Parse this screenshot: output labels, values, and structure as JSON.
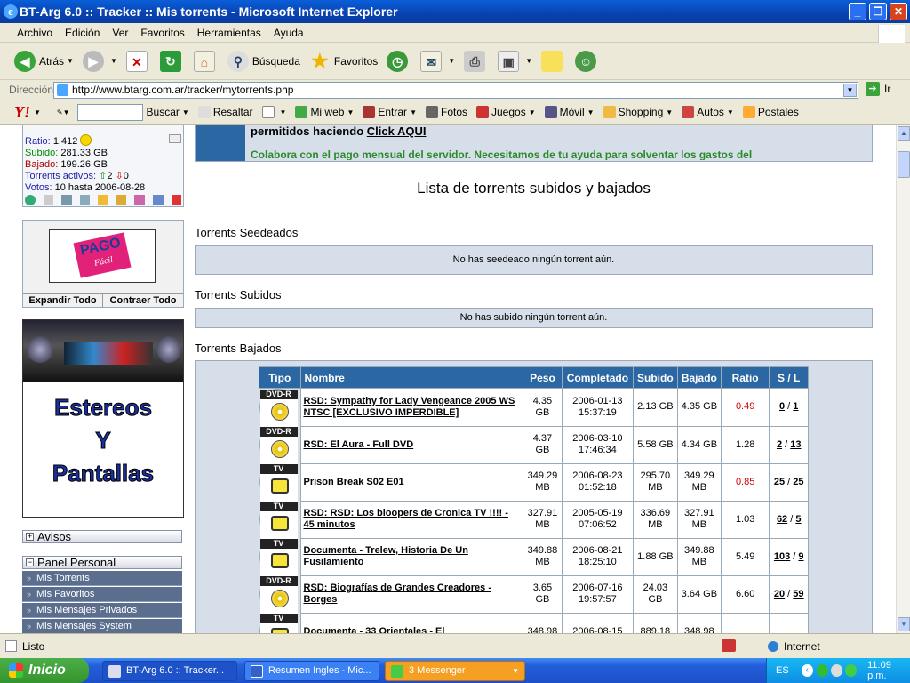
{
  "window": {
    "title": "BT-Arg 6.0 :: Tracker :: Mis torrents - Microsoft Internet Explorer"
  },
  "menu": [
    "Archivo",
    "Edición",
    "Ver",
    "Favoritos",
    "Herramientas",
    "Ayuda"
  ],
  "toolbar": {
    "back": "Atrás",
    "search": "Búsqueda",
    "favorites": "Favoritos"
  },
  "address": {
    "label": "Dirección",
    "url": "http://www.btarg.com.ar/tracker/mytorrents.php",
    "go": "Ir"
  },
  "yahoo": {
    "logo": "Y!",
    "search_btn": "Buscar",
    "highlight": "Resaltar",
    "myweb": "Mi web",
    "enter": "Entrar",
    "photos": "Fotos",
    "games": "Juegos",
    "mobile": "Móvil",
    "shopping": "Shopping",
    "autos": "Autos",
    "postcards": "Postales"
  },
  "user": {
    "ratio_label": "Ratio:",
    "ratio": "1.412",
    "up_label": "Subido:",
    "up": "281.33 GB",
    "down_label": "Bajado:",
    "down": "199.26 GB",
    "active_label": "Torrents activos:",
    "active_up": "2",
    "active_down": "0",
    "votes_label": "Votos:",
    "votes": "10 hasta 2006-08-28"
  },
  "sidebar": {
    "expand": "Expandir Todo",
    "collapse": "Contraer Todo",
    "ad_text": "Estereos Y Pantallas",
    "ad_line1": "Estereos",
    "ad_line2": "Y",
    "ad_line3": "Pantallas",
    "pago": "PAGO",
    "pago_sub": "Fácil",
    "avisos": "Avisos",
    "panel": "Panel Personal",
    "nav": [
      "Mis Torrents",
      "Mis Favoritos",
      "Mis Mensajes Privados",
      "Mis Mensajes System"
    ]
  },
  "notice": {
    "line1": "permitidos haciendo",
    "link": "Click AQUI",
    "line2": "Colabora con el pago mensual del servidor. Necesitamos de tu ayuda para solventar los gastos del"
  },
  "page": {
    "heading": "Lista de torrents subidos y bajados",
    "seeded_title": "Torrents Seedeados",
    "seeded_msg": "No has seedeado ningún torrent aún.",
    "uploaded_title": "Torrents Subidos",
    "uploaded_msg": "No has subido ningún torrent aún.",
    "downloaded_title": "Torrents Bajados"
  },
  "table": {
    "headers": [
      "Tipo",
      "Nombre",
      "Peso",
      "Completado",
      "Subido",
      "Bajado",
      "Ratio",
      "S / L"
    ],
    "rows": [
      {
        "type": "DVD-R",
        "name": "RSD: Sympathy for Lady Vengeance 2005 WS NTSC [EXCLUSIVO IMPERDIBLE]",
        "size": "4.35 GB",
        "completed": "2006-01-13 15:37:19",
        "up": "2.13 GB",
        "down": "4.35 GB",
        "ratio": "0.49",
        "seeds": "0",
        "leech": "1"
      },
      {
        "type": "DVD-R",
        "name": "RSD: El Aura - Full DVD",
        "size": "4.37 GB",
        "completed": "2006-03-10 17:46:34",
        "up": "5.58 GB",
        "down": "4.34 GB",
        "ratio": "1.28",
        "seeds": "2",
        "leech": "13"
      },
      {
        "type": "TV",
        "name": "Prison Break S02 E01",
        "size": "349.29 MB",
        "completed": "2006-08-23 01:52:18",
        "up": "295.70 MB",
        "down": "349.29 MB",
        "ratio": "0.85",
        "seeds": "25",
        "leech": "25"
      },
      {
        "type": "TV",
        "name": "RSD: RSD: Los bloopers de Cronica TV !!!! - 45 minutos",
        "size": "327.91 MB",
        "completed": "2005-05-19 07:06:52",
        "up": "336.69 MB",
        "down": "327.91 MB",
        "ratio": "1.03",
        "seeds": "62",
        "leech": "5"
      },
      {
        "type": "TV",
        "name": "Documenta - Trelew, Historia De Un Fusilamiento",
        "size": "349.88 MB",
        "completed": "2006-08-21 18:25:10",
        "up": "1.88 GB",
        "down": "349.88 MB",
        "ratio": "5.49",
        "seeds": "103",
        "leech": "9"
      },
      {
        "type": "DVD-R",
        "name": "RSD: Biografías de Grandes Creadores - Borges",
        "size": "3.65 GB",
        "completed": "2006-07-16 19:57:57",
        "up": "24.03 GB",
        "down": "3.64 GB",
        "ratio": "6.60",
        "seeds": "20",
        "leech": "59"
      },
      {
        "type": "TV",
        "name": "Documenta - 33 Orientales - El",
        "size": "348.98",
        "completed": "2006-08-15",
        "up": "889.18",
        "down": "348.98",
        "ratio": "",
        "seeds": "",
        "leech": ""
      }
    ]
  },
  "status": {
    "text": "Listo",
    "zone": "Internet"
  },
  "taskbar": {
    "start": "Inicio",
    "tasks": [
      "BT-Arg 6.0 :: Tracker...",
      "Resumen Ingles - Mic...",
      "3 Messenger"
    ],
    "lang": "ES",
    "clock": "11:09 p.m."
  },
  "colors": {
    "title_bar": "#0842b0",
    "table_header": "#2b67a3",
    "ratio_low": "#cc0000",
    "taskbar": "#245edb",
    "start": "#36942e"
  }
}
